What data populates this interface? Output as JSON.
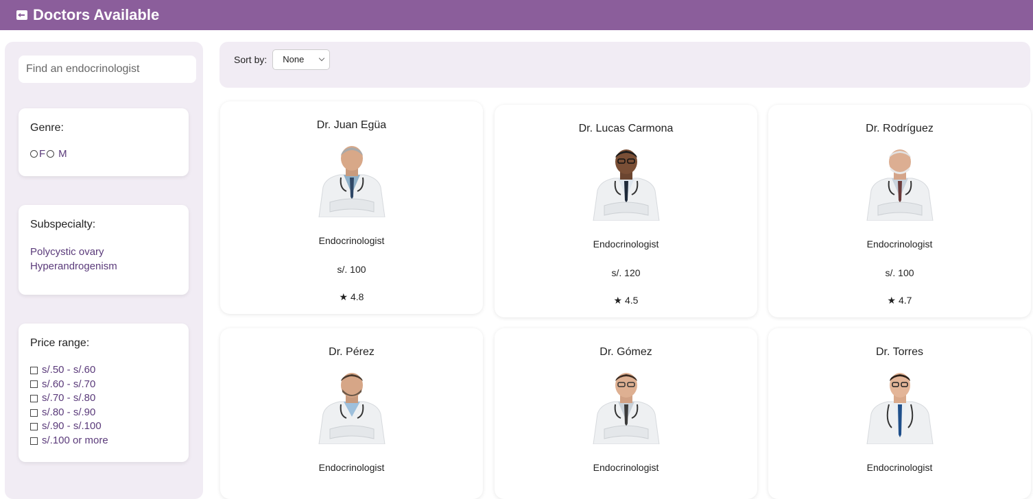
{
  "header": {
    "title": "Doctors Available",
    "icon": "back-arrow-icon",
    "color": "#8b5e9b"
  },
  "search": {
    "placeholder": "Find an endocrinologist"
  },
  "filters": {
    "genre": {
      "title": "Genre:",
      "options": [
        "F",
        "M"
      ]
    },
    "subspecialty": {
      "title": "Subspecialty:",
      "items": [
        "Polycystic ovary",
        "Hyperandrogenism"
      ]
    },
    "price": {
      "title": "Price range:",
      "options": [
        "s/.50 - s/.60",
        "s/.60 - s/.70",
        "s/.70 - s/.80",
        "s/.80 - s/.90",
        "s/.90 - s/.100",
        "s/.100 or more"
      ]
    }
  },
  "sort": {
    "label": "Sort by:",
    "selected": "None"
  },
  "doctors": [
    {
      "name": "Dr. Juan Egüa",
      "specialty": "Endocrinologist",
      "price": "s/. 100",
      "rating": "★ 4.8"
    },
    {
      "name": "Dr. Lucas Carmona",
      "specialty": "Endocrinologist",
      "price": "s/. 120",
      "rating": "★ 4.5"
    },
    {
      "name": "Dr. Rodríguez",
      "specialty": "Endocrinologist",
      "price": "s/. 100",
      "rating": "★ 4.7"
    },
    {
      "name": "Dr. Pérez",
      "specialty": "Endocrinologist",
      "price": "",
      "rating": ""
    },
    {
      "name": "Dr. Gómez",
      "specialty": "Endocrinologist",
      "price": "",
      "rating": ""
    },
    {
      "name": "Dr. Torres",
      "specialty": "Endocrinologist",
      "price": "",
      "rating": ""
    }
  ]
}
